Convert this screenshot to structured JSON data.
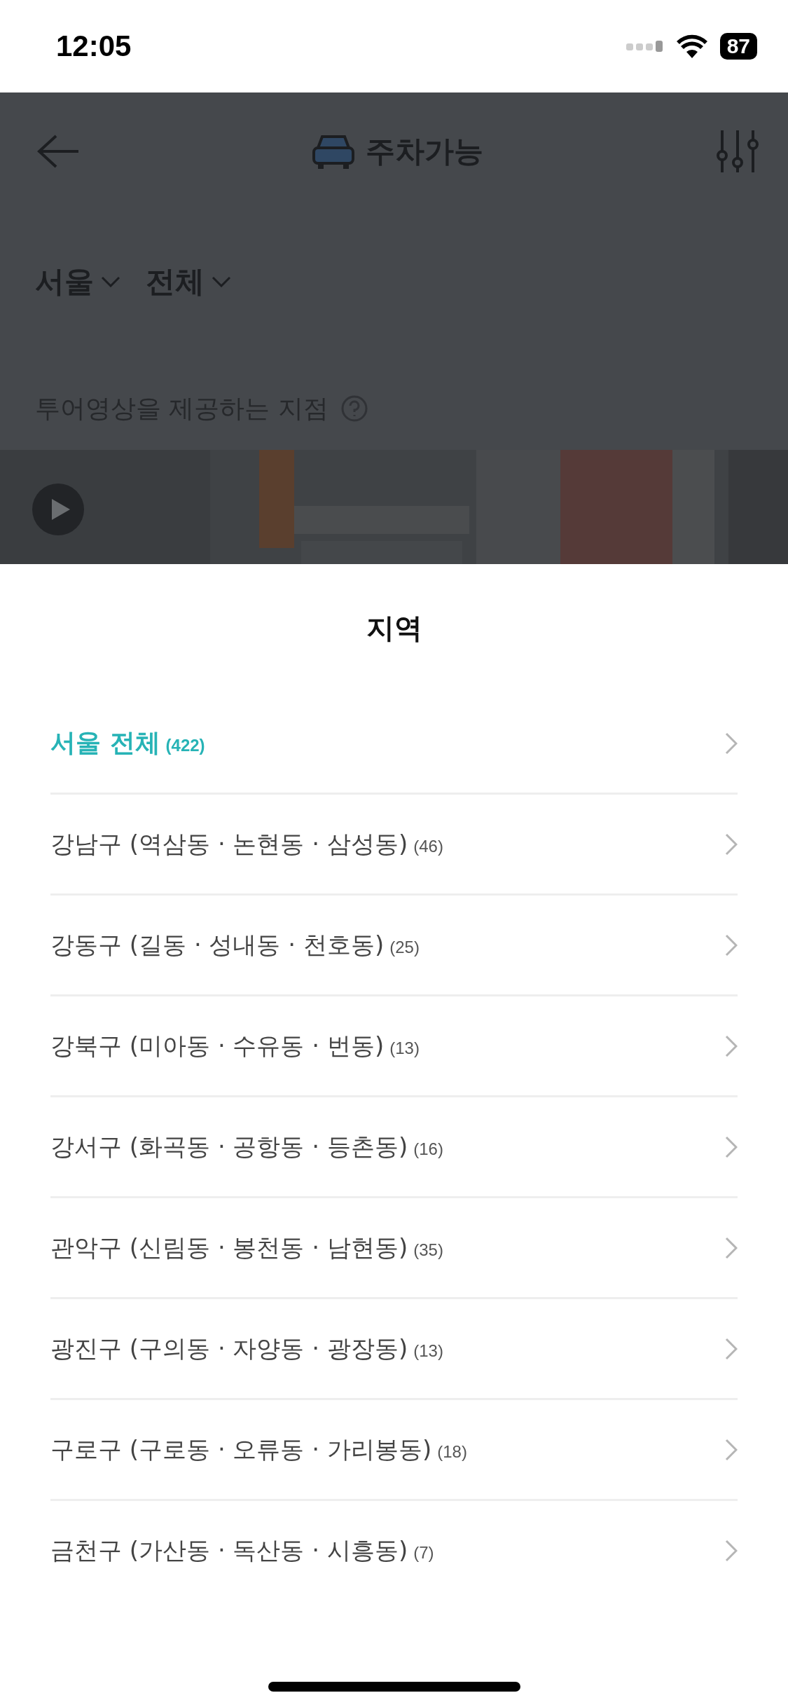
{
  "status_bar": {
    "time": "12:05",
    "battery": "87"
  },
  "header": {
    "title": "주차가능"
  },
  "filters": [
    {
      "label": "서울"
    },
    {
      "label": "전체"
    }
  ],
  "tour_label": "투어영상을 제공하는 지점",
  "sheet": {
    "title": "지역",
    "items": [
      {
        "name": "서울 전체",
        "count": "(422)",
        "selected": true
      },
      {
        "name": "강남구 (역삼동 · 논현동 · 삼성동)",
        "count": "(46)",
        "selected": false
      },
      {
        "name": "강동구 (길동 · 성내동 · 천호동)",
        "count": "(25)",
        "selected": false
      },
      {
        "name": "강북구 (미아동 · 수유동 · 번동)",
        "count": "(13)",
        "selected": false
      },
      {
        "name": "강서구 (화곡동 · 공항동 · 등촌동)",
        "count": "(16)",
        "selected": false
      },
      {
        "name": "관악구 (신림동 · 봉천동 · 남현동)",
        "count": "(35)",
        "selected": false
      },
      {
        "name": "광진구 (구의동 · 자양동 · 광장동)",
        "count": "(13)",
        "selected": false
      },
      {
        "name": "구로구 (구로동 · 오류동 · 가리봉동)",
        "count": "(18)",
        "selected": false
      },
      {
        "name": "금천구 (가산동 · 독산동 · 시흥동)",
        "count": "(7)",
        "selected": false
      }
    ]
  }
}
